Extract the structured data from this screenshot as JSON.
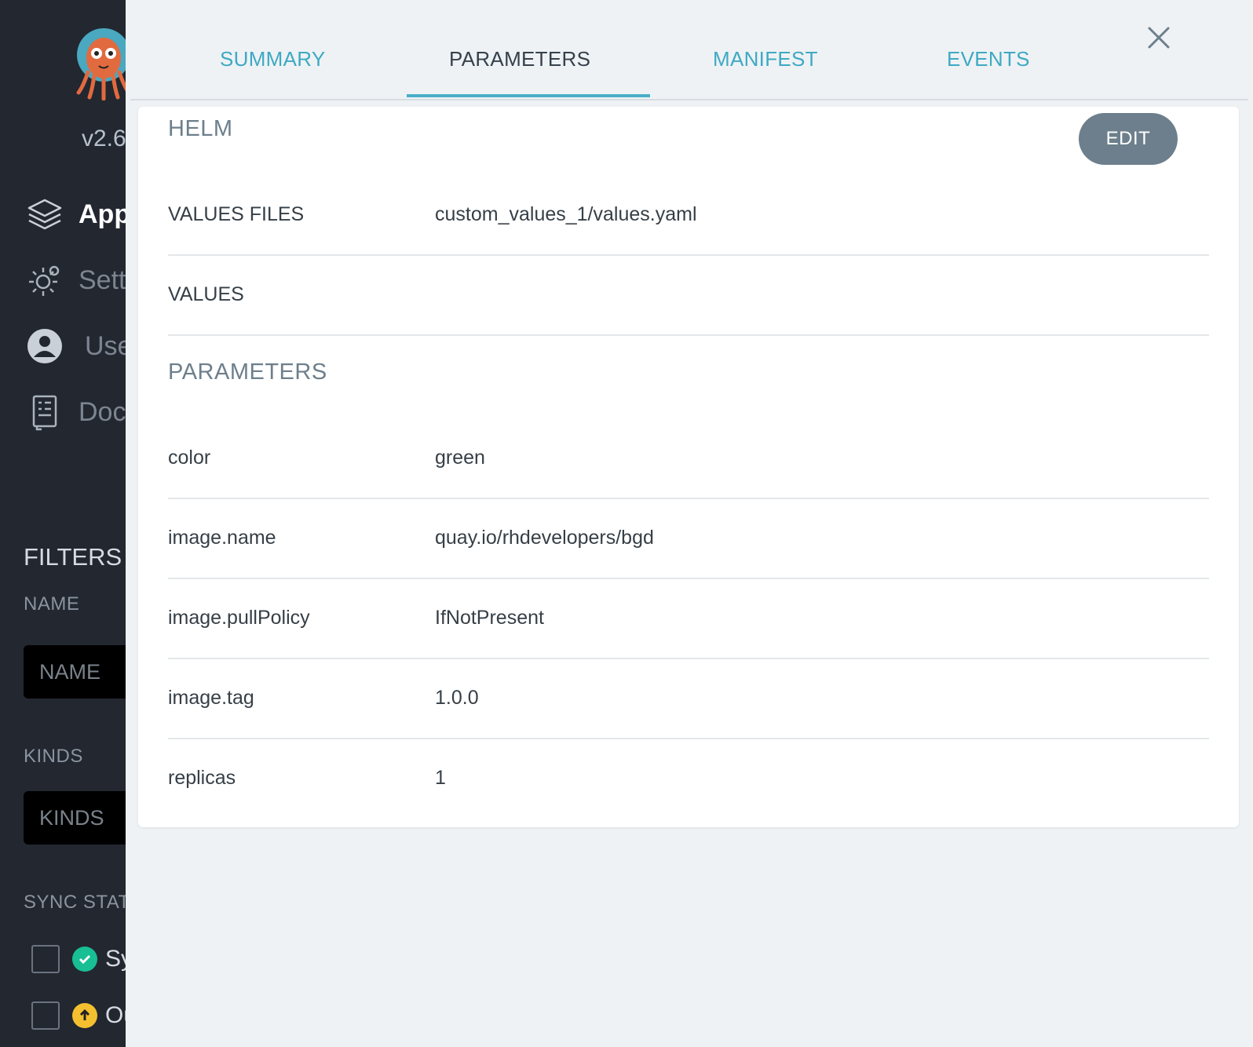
{
  "sidebar": {
    "version": "v2.6",
    "nav": [
      {
        "label": "Applications",
        "icon": "layers-icon"
      },
      {
        "label": "Settings",
        "icon": "gear-icon"
      },
      {
        "label": "User Info",
        "icon": "user-icon"
      },
      {
        "label": "Documentation",
        "icon": "book-icon"
      }
    ],
    "filters_title": "FILTERS",
    "name_label": "NAME",
    "name_placeholder": "NAME",
    "kinds_label": "KINDS",
    "kinds_placeholder": "KINDS",
    "sync_label": "SYNC STATUS",
    "sync_items": [
      {
        "label": "Synced",
        "color": "#18be94"
      },
      {
        "label": "OutOfSync",
        "color": "#f4c030"
      }
    ]
  },
  "tabs": [
    {
      "label": "SUMMARY"
    },
    {
      "label": "PARAMETERS"
    },
    {
      "label": "MANIFEST"
    },
    {
      "label": "EVENTS"
    }
  ],
  "helm": {
    "title": "HELM",
    "edit_label": "EDIT",
    "values_files_label": "VALUES FILES",
    "values_files_value": "custom_values_1/values.yaml",
    "values_label": "VALUES",
    "values_value": ""
  },
  "parameters": {
    "title": "PARAMETERS",
    "rows": [
      {
        "key": "color",
        "value": "green"
      },
      {
        "key": "image.name",
        "value": "quay.io/rhdevelopers/bgd"
      },
      {
        "key": "image.pullPolicy",
        "value": "IfNotPresent"
      },
      {
        "key": "image.tag",
        "value": "1.0.0"
      },
      {
        "key": "replicas",
        "value": "1"
      }
    ]
  },
  "colors": {
    "accent": "#4aafc7",
    "sidebar_bg": "#222730",
    "panel_bg": "#eef2f5"
  }
}
